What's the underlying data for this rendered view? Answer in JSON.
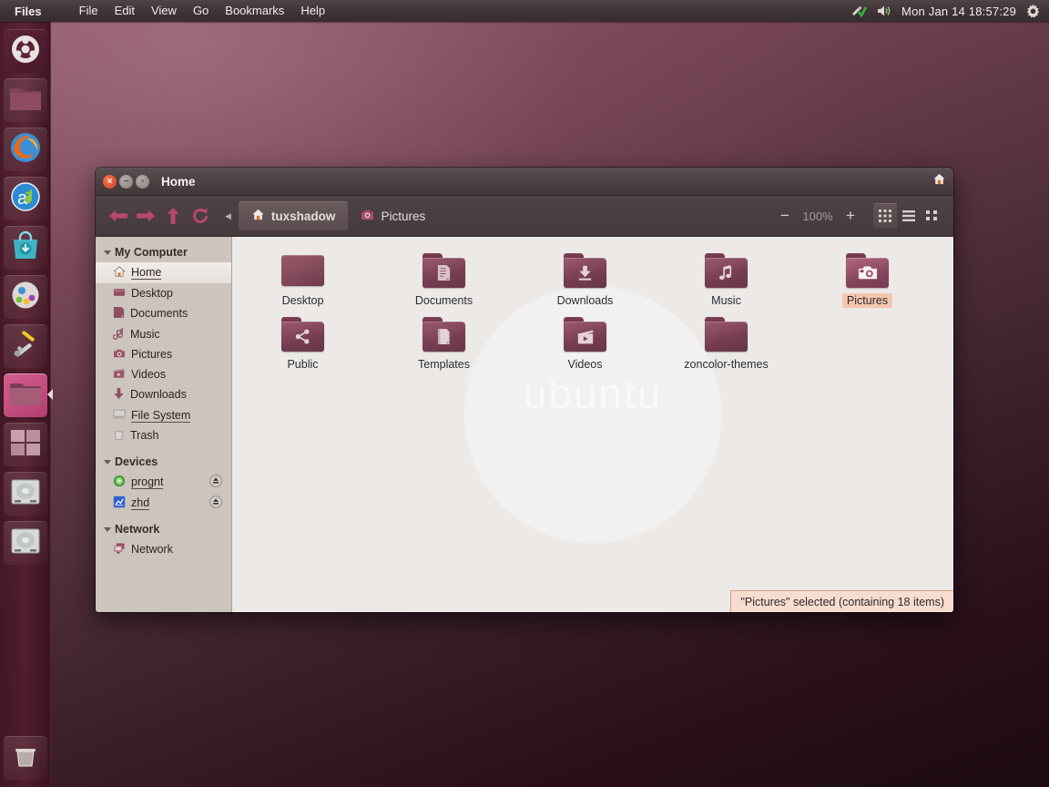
{
  "panel": {
    "app_name": "Files",
    "menus": [
      "File",
      "Edit",
      "View",
      "Go",
      "Bookmarks",
      "Help"
    ],
    "indicators": [
      "updates-icon",
      "volume-icon",
      "gear-icon"
    ],
    "clock": "Mon Jan 14  18:57:29"
  },
  "launcher": {
    "items": [
      {
        "name": "ubuntu-dash-icon",
        "label": "Dash home"
      },
      {
        "name": "files-folder-icon",
        "label": "Files"
      },
      {
        "name": "firefox-icon",
        "label": "Firefox Web Browser"
      },
      {
        "name": "rhythmbox-icon",
        "label": "Rhythmbox"
      },
      {
        "name": "software-center-icon",
        "label": "Ubuntu Software Center"
      },
      {
        "name": "apps-lens-icon",
        "label": "Applications"
      },
      {
        "name": "system-settings-icon",
        "label": "System Settings"
      },
      {
        "name": "files-active-icon",
        "label": "Files"
      },
      {
        "name": "workspace-switcher-icon",
        "label": "Workspace Switcher"
      },
      {
        "name": "drive-prognt-icon",
        "label": "prognt"
      },
      {
        "name": "drive-zhd-icon",
        "label": "zhd"
      },
      {
        "name": "trash-icon",
        "label": "Trash"
      }
    ]
  },
  "window": {
    "title": "Home",
    "buttons": {
      "close": "close-button",
      "minimize": "minimize-button",
      "maximize": "maximize-button"
    }
  },
  "toolbar": {
    "back": "back-button",
    "forward": "forward-button",
    "up": "up-button",
    "reload": "reload-button",
    "breadcrumbs": [
      {
        "label": "tuxshadow",
        "icon": "home-icon",
        "active": true
      },
      {
        "label": "Pictures",
        "icon": "camera-icon",
        "active": false
      }
    ],
    "zoom_out": "−",
    "zoom_level": "100%",
    "zoom_in": "+",
    "views": [
      {
        "name": "icon-view-button",
        "selected": true
      },
      {
        "name": "list-view-button",
        "selected": false
      },
      {
        "name": "compact-view-button",
        "selected": false
      }
    ]
  },
  "sidebar": {
    "sections": [
      {
        "title": "My Computer",
        "items": [
          {
            "label": "Home",
            "icon": "home-icon",
            "selected": true,
            "underline": true
          },
          {
            "label": "Desktop",
            "icon": "desktop-icon",
            "selected": false,
            "underline": false
          },
          {
            "label": "Documents",
            "icon": "documents-icon",
            "selected": false,
            "underline": false
          },
          {
            "label": "Music",
            "icon": "music-icon",
            "selected": false,
            "underline": false
          },
          {
            "label": "Pictures",
            "icon": "pictures-icon",
            "selected": false,
            "underline": false
          },
          {
            "label": "Videos",
            "icon": "videos-icon",
            "selected": false,
            "underline": false
          },
          {
            "label": "Downloads",
            "icon": "downloads-icon",
            "selected": false,
            "underline": false
          },
          {
            "label": "File System",
            "icon": "filesystem-icon",
            "selected": false,
            "underline": true
          },
          {
            "label": "Trash",
            "icon": "trash-icon",
            "selected": false,
            "underline": false
          }
        ]
      },
      {
        "title": "Devices",
        "items": [
          {
            "label": "prognt",
            "icon": "optical-disc-icon",
            "selected": false,
            "underline": true,
            "eject": true
          },
          {
            "label": "zhd",
            "icon": "drive-icon",
            "selected": false,
            "underline": true,
            "eject": true
          }
        ]
      },
      {
        "title": "Network",
        "items": [
          {
            "label": "Network",
            "icon": "network-icon",
            "selected": false,
            "underline": false
          }
        ]
      }
    ]
  },
  "fileview": {
    "watermark": "ubuntu",
    "files": [
      {
        "label": "Desktop",
        "icon": "folder-desktop-icon",
        "emblem": "none",
        "selected": false
      },
      {
        "label": "Documents",
        "icon": "folder-documents-icon",
        "emblem": "document",
        "selected": false
      },
      {
        "label": "Downloads",
        "icon": "folder-downloads-icon",
        "emblem": "download",
        "selected": false
      },
      {
        "label": "Music",
        "icon": "folder-music-icon",
        "emblem": "note",
        "selected": false
      },
      {
        "label": "Pictures",
        "icon": "folder-pictures-icon",
        "emblem": "camera",
        "selected": true
      },
      {
        "label": "Public",
        "icon": "folder-public-icon",
        "emblem": "share",
        "selected": false
      },
      {
        "label": "Templates",
        "icon": "folder-templates-icon",
        "emblem": "template",
        "selected": false
      },
      {
        "label": "Videos",
        "icon": "folder-videos-icon",
        "emblem": "video",
        "selected": false
      },
      {
        "label": "zoncolor-themes",
        "icon": "folder-icon",
        "emblem": "none",
        "selected": false
      }
    ]
  },
  "statusbar": {
    "text": "\"Pictures\" selected (containing 18 items)"
  },
  "colors": {
    "panel_bg": "#3f3335",
    "launcher_bg": "#52213b",
    "folder": "#8a4c60",
    "selection": "#f4c6ad",
    "sidebar_bg": "#cdc4be",
    "fileview_bg": "#ece9e7",
    "statusbar_bg": "#f6ddd0"
  }
}
